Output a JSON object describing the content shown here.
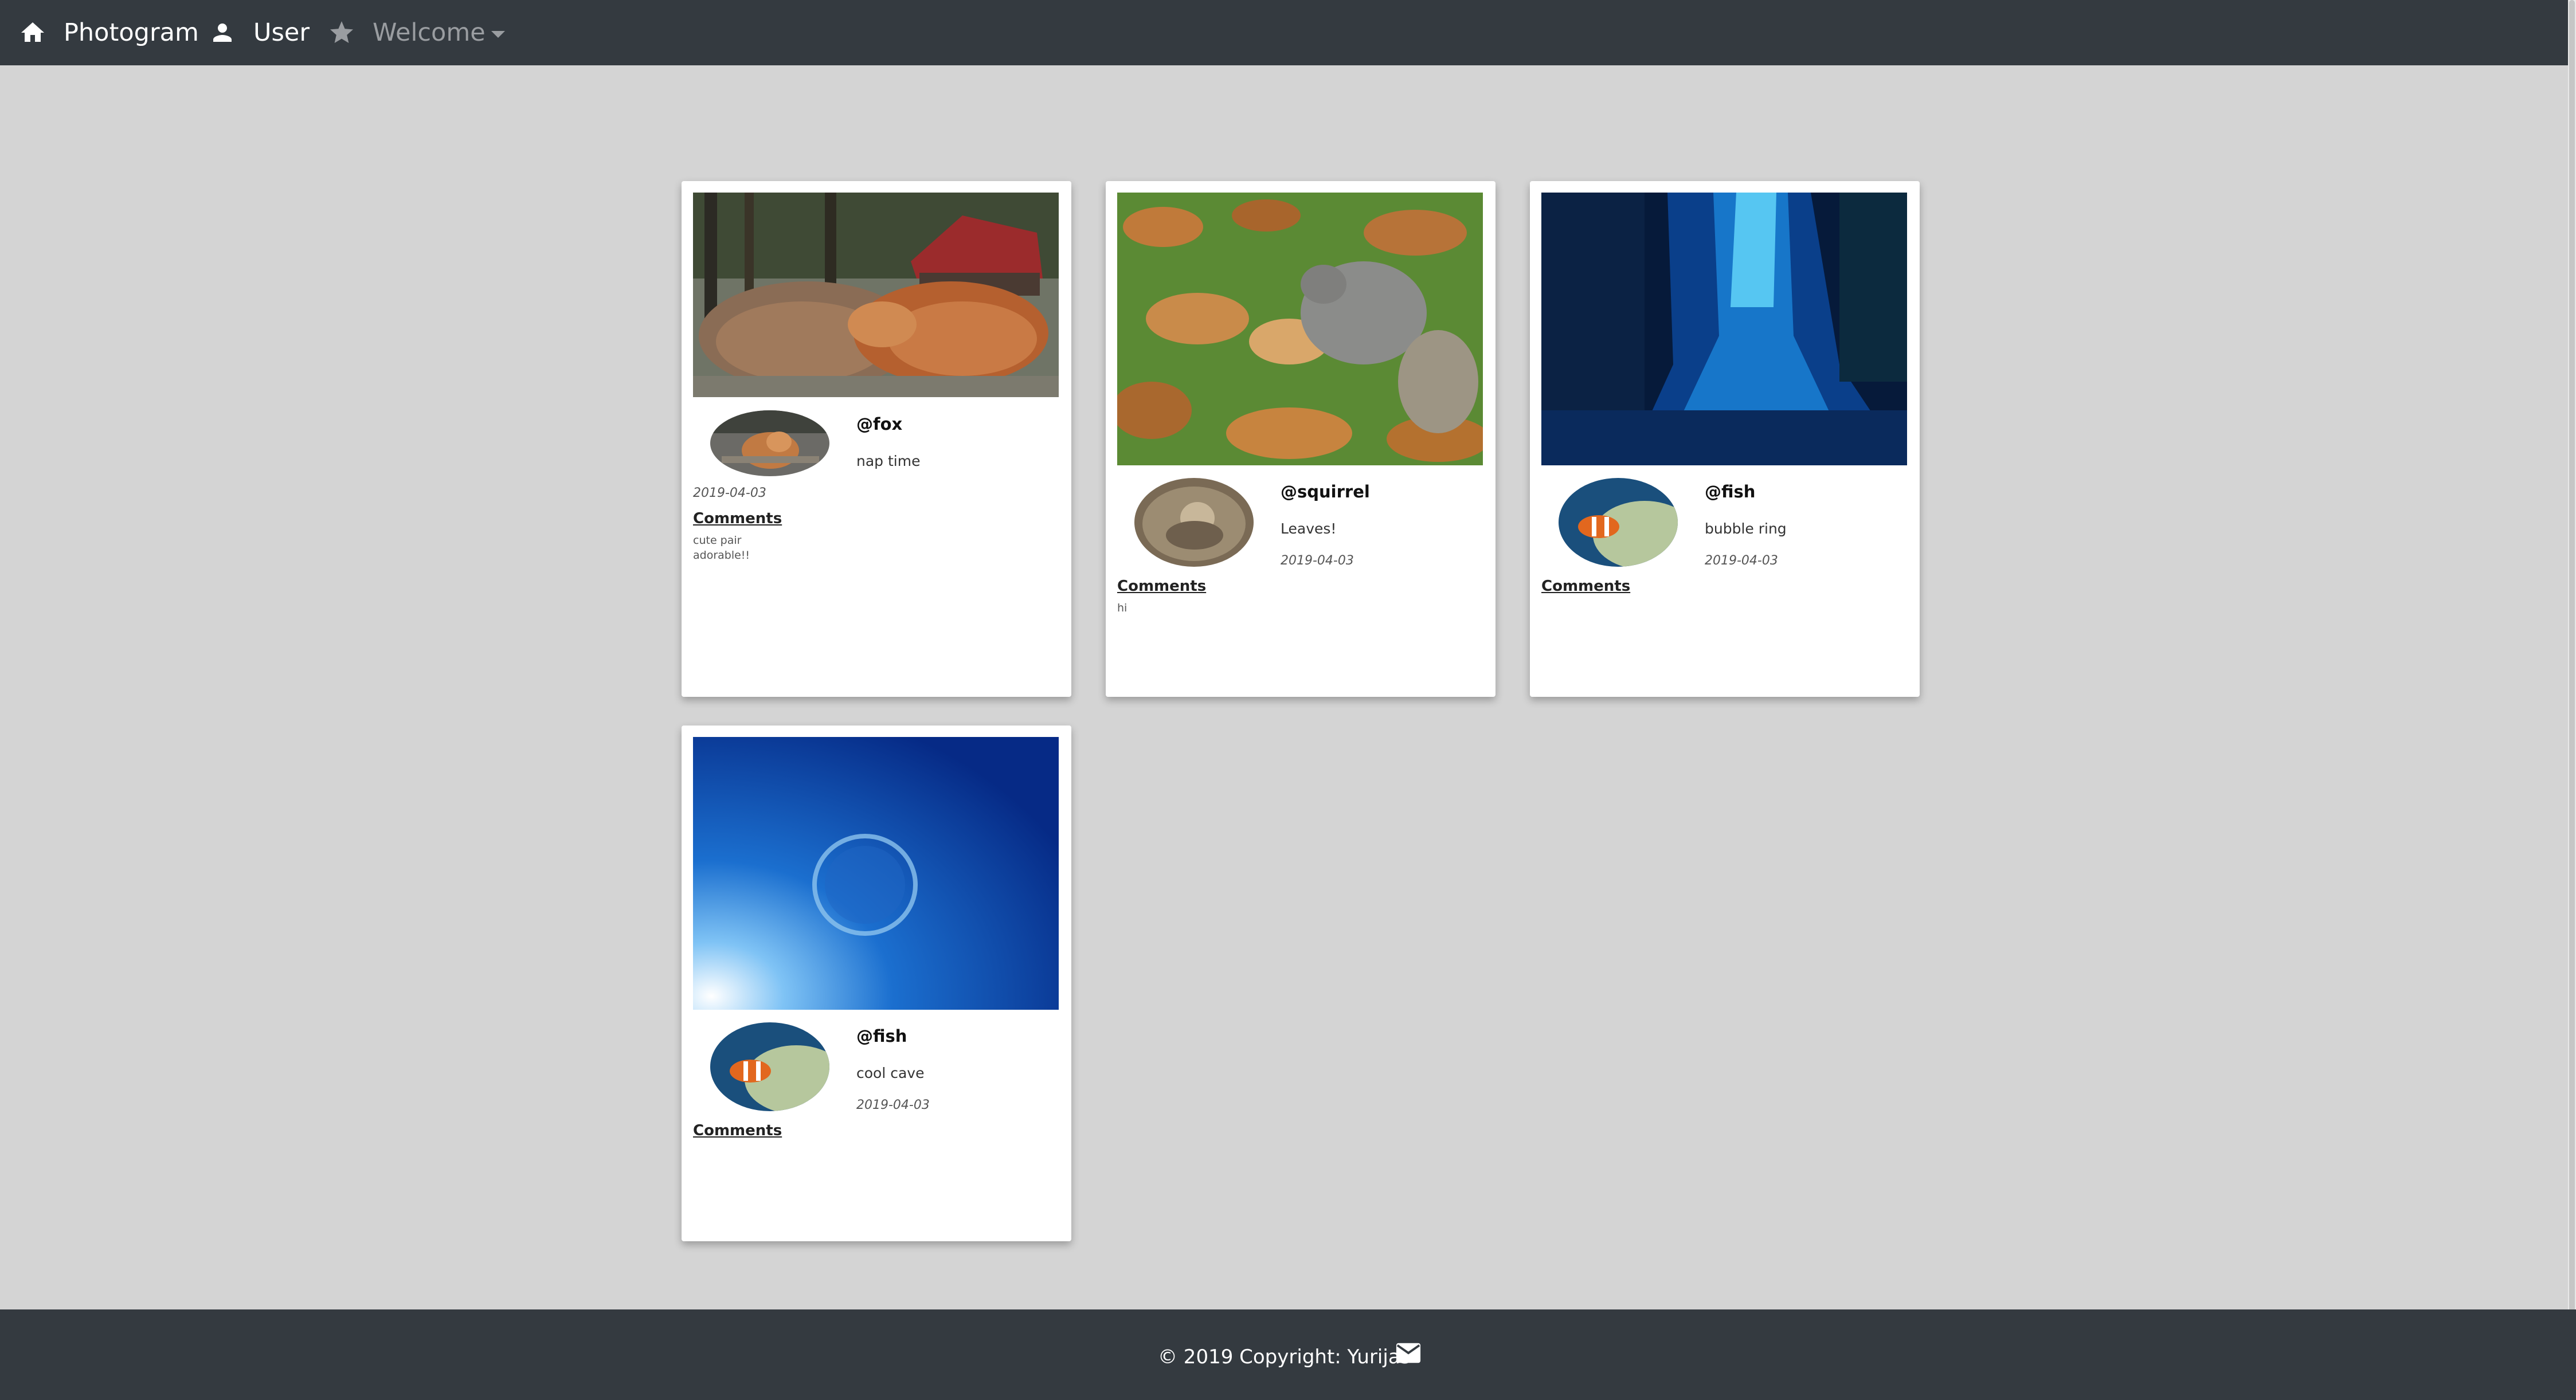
{
  "nav": {
    "brand": "Photogram",
    "user": "User",
    "welcome": "Welcome"
  },
  "posts": [
    {
      "username": "@fox",
      "caption": "nap time",
      "date": "2019-04-03",
      "comments_label": "Comments",
      "comments": [
        "cute pair",
        "adorable!!"
      ]
    },
    {
      "username": "@squirrel",
      "caption": "Leaves!",
      "date": "2019-04-03",
      "comments_label": "Comments",
      "comments": [
        "hi"
      ]
    },
    {
      "username": "@fish",
      "caption": "bubble ring",
      "date": "2019-04-03",
      "comments_label": "Comments",
      "comments": []
    },
    {
      "username": "@fish",
      "caption": "cool cave",
      "date": "2019-04-03",
      "comments_label": "Comments",
      "comments": []
    }
  ],
  "footer": {
    "copyright": "© 2019 Copyright: Yurijas"
  },
  "colors": {
    "navbar": "#343a40",
    "background": "#d4d4d4",
    "card": "#ffffff"
  }
}
